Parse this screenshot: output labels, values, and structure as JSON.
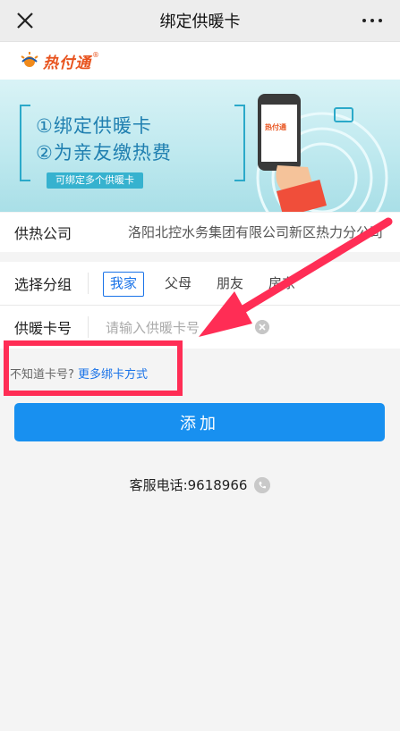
{
  "nav": {
    "title": "绑定供暖卡"
  },
  "logo": {
    "text": "热付通",
    "reg": "®"
  },
  "banner": {
    "line1": "①绑定供暖卡",
    "line2": "②为亲友缴热费",
    "tag": "可绑定多个供暖卡",
    "phone_logo": "热付通"
  },
  "company": {
    "label": "供热公司",
    "value": "洛阳北控水务集团有限公司新区热力分公司"
  },
  "group": {
    "label": "选择分组",
    "options": [
      "我家",
      "父母",
      "朋友",
      "房东"
    ],
    "selected": "我家"
  },
  "card": {
    "label": "供暖卡号",
    "placeholder": "请输入供暖卡号"
  },
  "hint": {
    "text": "不知道卡号?",
    "link": "更多绑卡方式"
  },
  "add_button": {
    "label": "添加"
  },
  "service": {
    "label": "客服电话:",
    "phone": "9618966"
  },
  "colors": {
    "primary": "#1890f0",
    "link": "#1a73e8",
    "annotation": "#ff2d55",
    "brand": "#e8531e"
  },
  "icons": [
    "close-icon",
    "more-icon",
    "sun-logo-icon",
    "clear-icon",
    "phone-icon",
    "card-icon"
  ]
}
